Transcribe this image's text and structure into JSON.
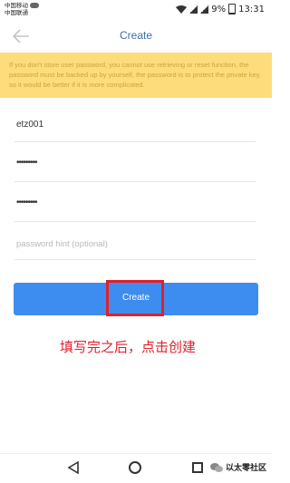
{
  "status_bar": {
    "carrier_1": "中国移动",
    "carrier_2": "中国联通",
    "battery": "9%",
    "time": "13:31"
  },
  "header": {
    "title": "Create"
  },
  "warning": {
    "text": "If you don't store user password, you cannot use retrieving or reset function, the password must be backed up by yourself, the password is to protect the private key, so it would be better if it is more complicated."
  },
  "form": {
    "wallet_name": "etz001",
    "password_masked": "•••••••••",
    "confirm_password_masked": "•••••••••",
    "password_hint_placeholder": "password hint (optional)"
  },
  "actions": {
    "create_label": "Create"
  },
  "annotation": {
    "text": "填写完之后，点击创建",
    "color": "#e21f2b"
  },
  "watermark": {
    "text": "以太零社区"
  },
  "colors": {
    "accent": "#3d8df0",
    "title": "#3d6bb0",
    "warning_bg": "#fddc7b",
    "warning_text": "#c9a63b"
  }
}
